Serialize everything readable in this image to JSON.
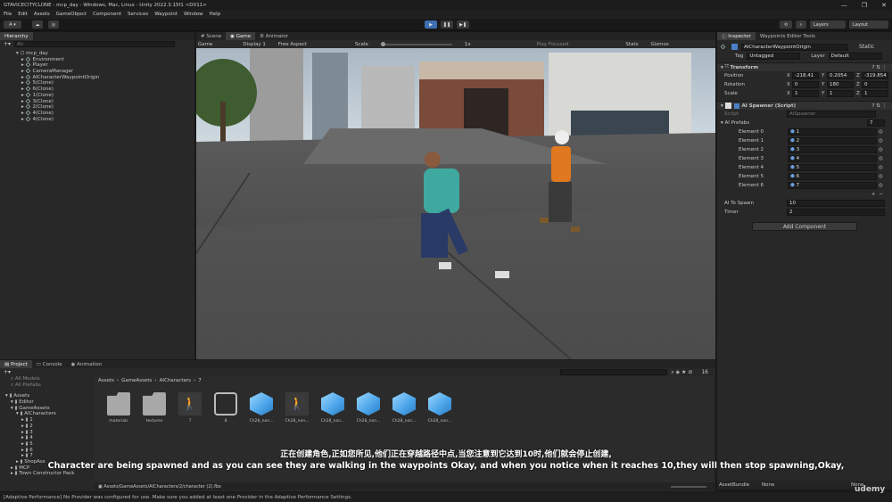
{
  "window": {
    "title": "GTAVICECITYCLONE - mcp_day - Windows, Mac, Linux - Unity 2022.3.15f1 <DX11>",
    "controls": [
      "—",
      "❐",
      "✕"
    ]
  },
  "menu": [
    "File",
    "Edit",
    "Assets",
    "GameObject",
    "Component",
    "Services",
    "Waypoint",
    "Window",
    "Help"
  ],
  "toolbar": {
    "account": "A ▾",
    "layers": "Layers",
    "layout": "Layout"
  },
  "hierarchy": {
    "tab": "Hierarchy",
    "search_placeholder": "All",
    "scene": "mcp_day",
    "items": [
      "Environment",
      "Player",
      "CameraManager",
      "AICharacterWaypointOrigin",
      "5(Clone)",
      "6(Clone)",
      "1(Clone)",
      "3(Clone)",
      "2(Clone)",
      "4(Clone)",
      "4(Clone)"
    ]
  },
  "center_tabs": [
    "Scene",
    "Game",
    "Animator"
  ],
  "game_bar": {
    "display_mode": "Game",
    "display": "Display 1",
    "aspect": "Free Aspect",
    "scale_label": "Scale",
    "scale_value": "1x",
    "play_focused": "Play Focused",
    "stats": "Stats",
    "gizmos": "Gizmos"
  },
  "inspector": {
    "tabs": [
      "Inspector",
      "Waypoints Editor Tools"
    ],
    "object_name": "AICharacterWaypointOrigin",
    "static": "Static",
    "tag_label": "Tag",
    "tag_value": "Untagged",
    "layer_label": "Layer",
    "layer_value": "Default",
    "transform": {
      "title": "Transform",
      "position": {
        "label": "Position",
        "x": "-218.41",
        "y": "0.2054",
        "z": "-319.854"
      },
      "rotation": {
        "label": "Rotation",
        "x": "0",
        "y": "180",
        "z": "0"
      },
      "scale": {
        "label": "Scale",
        "x": "1",
        "y": "1",
        "z": "1"
      }
    },
    "spawner": {
      "title": "AI Spawner (Script)",
      "script_label": "Script",
      "script_value": "AISpawner",
      "prefabs_label": "AI Prefabs",
      "prefabs_count": "7",
      "elements": [
        {
          "label": "Element 0",
          "value": "1"
        },
        {
          "label": "Element 1",
          "value": "2"
        },
        {
          "label": "Element 2",
          "value": "3"
        },
        {
          "label": "Element 3",
          "value": "4"
        },
        {
          "label": "Element 4",
          "value": "5"
        },
        {
          "label": "Element 5",
          "value": "6"
        },
        {
          "label": "Element 6",
          "value": "7"
        }
      ],
      "to_spawn_label": "AI To Spawn",
      "to_spawn_value": "10",
      "timer_label": "Timer",
      "timer_value": "2"
    },
    "add_component": "Add Component",
    "asset_bundle_label": "AssetBundle",
    "asset_bundle_value": "None",
    "asset_bundle_variant": "None"
  },
  "project": {
    "tabs": [
      "Project",
      "Console",
      "Animation"
    ],
    "favorites": [
      "All Models",
      "All Prefabs"
    ],
    "tree": [
      {
        "label": "Assets",
        "indent": 0
      },
      {
        "label": "Editor",
        "indent": 1
      },
      {
        "label": "GameAssets",
        "indent": 1
      },
      {
        "label": "AICharacters",
        "indent": 2
      },
      {
        "label": "1",
        "indent": 3
      },
      {
        "label": "2",
        "indent": 3
      },
      {
        "label": "3",
        "indent": 3
      },
      {
        "label": "4",
        "indent": 3
      },
      {
        "label": "5",
        "indent": 3
      },
      {
        "label": "6",
        "indent": 3
      },
      {
        "label": "7",
        "indent": 3
      },
      {
        "label": "ShopAss",
        "indent": 2
      },
      {
        "label": "MCP",
        "indent": 1
      },
      {
        "label": "Town Constructor Pack",
        "indent": 1
      }
    ],
    "breadcrumb": [
      "Assets",
      "GameAssets",
      "AICharacters",
      "7"
    ],
    "assets": [
      {
        "label": "materials",
        "kind": "folder"
      },
      {
        "label": "textures",
        "kind": "folder"
      },
      {
        "label": "7",
        "kind": "figure"
      },
      {
        "label": "8",
        "kind": "link"
      },
      {
        "label": "Ch28_non...",
        "kind": "box"
      },
      {
        "label": "Ch28_non...",
        "kind": "figure"
      },
      {
        "label": "Ch28_non...",
        "kind": "box"
      },
      {
        "label": "Ch28_non...",
        "kind": "box"
      },
      {
        "label": "Ch28_non...",
        "kind": "box"
      },
      {
        "label": "Ch28_non...",
        "kind": "box"
      }
    ],
    "count": "16",
    "path": "Assets/GameAssets/AICharacters/2/character (2).fbx"
  },
  "status": "[Adaptive Performance] No Provider was configured for use. Make sure you added at least one Provider in the Adaptive Performance Settings.",
  "subtitles": {
    "zh": "正在创建角色,正如您所见,他们正在穿越路径中点,当您注意到它达到10时,他们就会停止创建,",
    "en": "Character are being spawned and as you can see they are walking in the waypoints Okay, and when you notice when it reaches 10,they will then stop spawning,Okay,"
  },
  "watermark": "udemy"
}
